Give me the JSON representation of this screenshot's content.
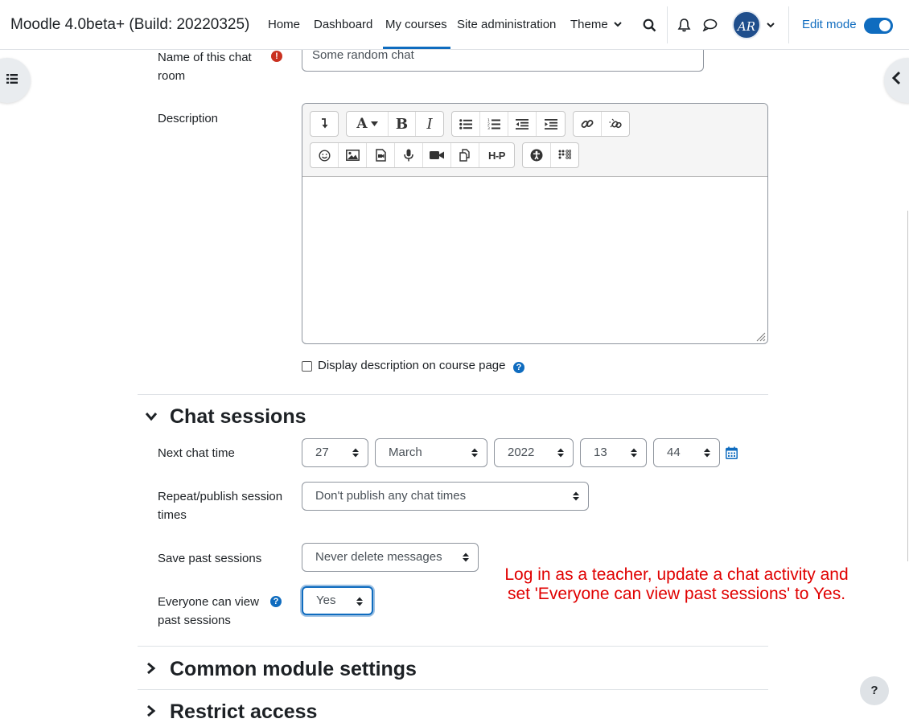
{
  "navbar": {
    "site_name": "Moodle 4.0beta+ (Build: 20220325)",
    "items": [
      {
        "label": "Home"
      },
      {
        "label": "Dashboard"
      },
      {
        "label": "My courses"
      },
      {
        "label": "Site administration"
      },
      {
        "label": "Theme"
      }
    ],
    "active_item": "My courses",
    "avatar_initials": "AR",
    "edit_mode_label": "Edit mode",
    "edit_mode_on": true,
    "accent_color": "#0f6cbf"
  },
  "form": {
    "chat_name": {
      "label": "Name of this chat room",
      "value": "Some random chat",
      "required": true
    },
    "description": {
      "label": "Description",
      "toolbar_row1": [
        "insert-icon",
        "font-color-icon",
        "bold-icon",
        "italic-icon",
        "unordered-list-icon",
        "ordered-list-icon",
        "outdent-icon",
        "indent-icon",
        "link-icon",
        "unlink-icon"
      ],
      "toolbar_row2": [
        "emoji-icon",
        "image-icon",
        "media-icon",
        "record-audio-icon",
        "record-video-icon",
        "manage-files-icon",
        "h5p-icon",
        "accessibility-checker-icon",
        "screenreader-helper-icon"
      ],
      "bold_glyph": "B",
      "italic_glyph": "I",
      "font_glyph": "A",
      "h5p_label": "H-P",
      "display_on_course_label": "Display description on course page"
    }
  },
  "sections": {
    "chat_sessions": {
      "title": "Chat sessions",
      "expanded": true,
      "next_chat_time": {
        "label": "Next chat time",
        "day": "27",
        "month": "March",
        "year": "2022",
        "hour": "13",
        "minute": "44"
      },
      "repeat_publish": {
        "label": "Repeat/publish session times",
        "value": "Don't publish any chat times"
      },
      "save_past": {
        "label": "Save past sessions",
        "value": "Never delete messages"
      },
      "everyone_view": {
        "label": "Everyone can view past sessions",
        "value": "Yes"
      }
    },
    "common_module": {
      "title": "Common module settings",
      "expanded": false
    },
    "restrict_access": {
      "title": "Restrict access",
      "expanded": false
    }
  },
  "annotation": "Log in as a teacher, update a chat activity and set 'Everyone can view past sessions' to Yes.",
  "help_button_label": "?"
}
